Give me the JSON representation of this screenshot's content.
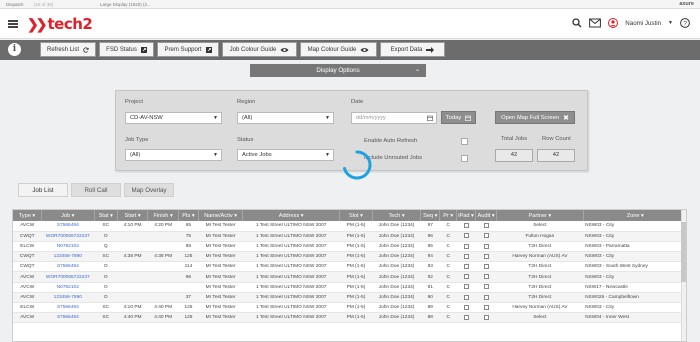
{
  "browser": {
    "tab1": "Dispatch",
    "tab1_sub": "(16 of 36)",
    "tab2": "Large Display (1920) (2...",
    "brand": "axure"
  },
  "header": {
    "logo_text": "tech2",
    "user_name": "Naomi Justin"
  },
  "toolbar": {
    "buttons": [
      {
        "label": "Refresh List",
        "icon": "refresh-icon"
      },
      {
        "label": "FSD Status",
        "icon": "external-icon"
      },
      {
        "label": "Prem Support",
        "icon": "external-icon"
      },
      {
        "label": "Job Colour Guide",
        "icon": "eye-icon"
      },
      {
        "label": "Map Colour Guide",
        "icon": "eye-icon"
      },
      {
        "label": "Export Data",
        "icon": "arrow-right-icon"
      }
    ]
  },
  "display_options": {
    "label": "Display Options"
  },
  "filters": {
    "project_label": "Project",
    "project_value": "CD-AV-NSW",
    "region_label": "Region",
    "region_value": "(All)",
    "date_label": "Date",
    "date_placeholder": "dd/mm/yyyy",
    "today_label": "Today",
    "map_full_label": "Open Map Full Screen",
    "jobtype_label": "Job Type",
    "jobtype_value": "(All)",
    "status_label": "Status",
    "status_value": "Active Jobs",
    "auto_refresh_label": "Enable Auto Refresh",
    "unrouted_label": "Include Unrouted Jobs",
    "total_jobs_label": "Total Jobs",
    "total_jobs_value": "42",
    "row_count_label": "Row Count",
    "row_count_value": "42"
  },
  "tabs": [
    "Job List",
    "Roll Call",
    "Map Overlay"
  ],
  "table": {
    "headers": [
      "Type",
      "Job",
      "Stat",
      "Start",
      "Finish",
      "Pts",
      "Name/Activ",
      "Address",
      "Slot",
      "Tech",
      "Seq",
      "Pr",
      "iPad",
      "Audit",
      "Partner",
      "Zone"
    ],
    "rows": [
      [
        "AVCW",
        "S7566494",
        "SC",
        "4:10 PM",
        "4:20 PM",
        "65",
        "Mr Test Tester",
        "1 Test Street ULTIMO NSW 2007",
        "PM (1-5)",
        "John Doe (1234)",
        "97",
        "C",
        "",
        "",
        "Select",
        "NSW03 - City"
      ],
      [
        "CWQT",
        "WOR700065722237",
        "O",
        "",
        "",
        "75",
        "Mr Test Tester",
        "1 Test Street ULTIMO NSW 2007",
        "PM (1-5)",
        "John Doe (1234)",
        "96",
        "C",
        "",
        "",
        "Fulton Hogan",
        "NSW03 - City"
      ],
      [
        "ELCW",
        "N0762102",
        "Q",
        "",
        "",
        "88",
        "Mr Test Tester",
        "1 Test Street ULTIMO NSW 2007",
        "PM (1-5)",
        "John Doe (1234)",
        "95",
        "C",
        "",
        "",
        "T2H Direct",
        "NSW03 - Parramatta"
      ],
      [
        "CWQT",
        "123456-7890",
        "SC",
        "4:38 PM",
        "4:38 PM",
        "125",
        "Mr Test Tester",
        "1 Test Street ULTIMO NSW 2007",
        "PM (1-5)",
        "John Doe (1234)",
        "94",
        "C",
        "",
        "",
        "Harvey Norman (AUS) AV",
        "NSW03 - City"
      ],
      [
        "CWQT",
        "S7566494",
        "O",
        "",
        "",
        "114",
        "Mr Test Tester",
        "1 Test Street ULTIMO NSW 2007",
        "PM (1-5)",
        "John Doe (1234)",
        "93",
        "C",
        "",
        "",
        "T2H Direct",
        "NSW03 - South West Sydney"
      ],
      [
        "AVCW",
        "WOR700065722237",
        "O",
        "",
        "",
        "96",
        "Mr Test Tester",
        "1 Test Street ULTIMO NSW 2007",
        "PM (1-5)",
        "John Doe (1234)",
        "92",
        "C",
        "",
        "",
        "T2H Direct",
        "NSW03 - City"
      ],
      [
        "AVCW",
        "N0762102",
        "O",
        "",
        "",
        "",
        "Mr Test Tester",
        "1 Test Street ULTIMO NSW 2007",
        "PM (1-5)",
        "John Doe (1234)",
        "91",
        "C",
        "",
        "",
        "T2H Direct",
        "NSW17 - Newcastle"
      ],
      [
        "AVCW",
        "123456-7890",
        "O",
        "",
        "",
        "37",
        "Mr Test Tester",
        "1 Test Street ULTIMO NSW 2007",
        "PM (1-5)",
        "John Doe (1234)",
        "90",
        "C",
        "",
        "",
        "T2H Direct",
        "NSW026 - Campbelltown"
      ],
      [
        "ELCW",
        "S7566494",
        "SC",
        "4:10 PM",
        "4:40 PM",
        "125",
        "Mr Test Tester",
        "1 Test Street ULTIMO NSW 2007",
        "PM (1-5)",
        "John Doe (1234)",
        "89",
        "C",
        "",
        "",
        "Harvey Norman (AUS) AV",
        "NSW03 - City"
      ],
      [
        "AVCW",
        "S7566494",
        "SC",
        "4:40 PM",
        "4:40 PM",
        "125",
        "Mr Test Tester",
        "1 Test Street ULTIMO NSW 2007",
        "PM (1-5)",
        "John Doe (1234)",
        "88",
        "C",
        "",
        "",
        "Select",
        "NSW04 - Inner West"
      ]
    ]
  },
  "colors": {
    "brand_red": "#e0202a",
    "toolbar": "#6c6c6c",
    "spinner": "#1aa3e0",
    "link": "#3a6ad1"
  }
}
